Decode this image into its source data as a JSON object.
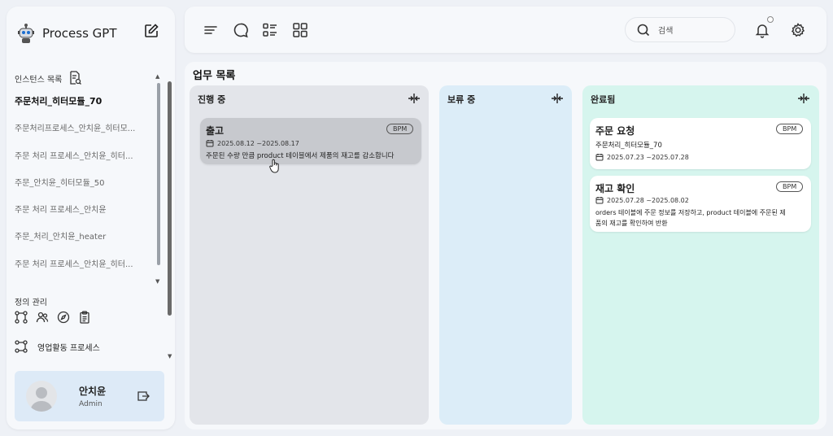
{
  "app": {
    "title": "Process GPT"
  },
  "sidebar": {
    "instances_label": "인스턴스 목록",
    "instances": [
      "주문처리_히터모듈_70",
      "주문처리프로세스_안치윤_히터모...",
      "주문 처리 프로세스_안치윤_히터...",
      "주문_안치윤_히터모듈_50",
      "주문 처리 프로세스_안치윤",
      "주문_처리_안치윤_heater",
      "주문 처리 프로세스_안치윤_히터..."
    ],
    "definitions_label": "정의 관리",
    "process_item": "영업활동 프로세스",
    "user": {
      "name": "안치윤",
      "role": "Admin"
    }
  },
  "topbar": {
    "search_placeholder": "검색"
  },
  "main": {
    "title": "업무 목록",
    "columns": [
      {
        "title": "진행 중",
        "color": "#e3e5ea",
        "cards": [
          {
            "title": "출고",
            "badge": "BPM",
            "date": "2025.08.12 ~2025.08.17",
            "desc": "주문된 수량 만큼 product 테이블에서 제품의 재고를 감소합니다"
          }
        ]
      },
      {
        "title": "보류 중",
        "color": "#dcedf8",
        "cards": []
      },
      {
        "title": "완료됨",
        "color": "#d6f5ee",
        "cards": [
          {
            "title": "주문 요청",
            "badge": "BPM",
            "subtitle": "주문처리_히터모듈_70",
            "date": "2025.07.23 ~2025.07.28"
          },
          {
            "title": "재고 확인",
            "badge": "BPM",
            "date": "2025.07.28 ~2025.08.02",
            "desc1": "orders 테이블에 주문 정보를 저장하고, product 테이블에 주문된 제",
            "desc2": "품의 재고를 확인하여 반환"
          }
        ]
      }
    ]
  }
}
